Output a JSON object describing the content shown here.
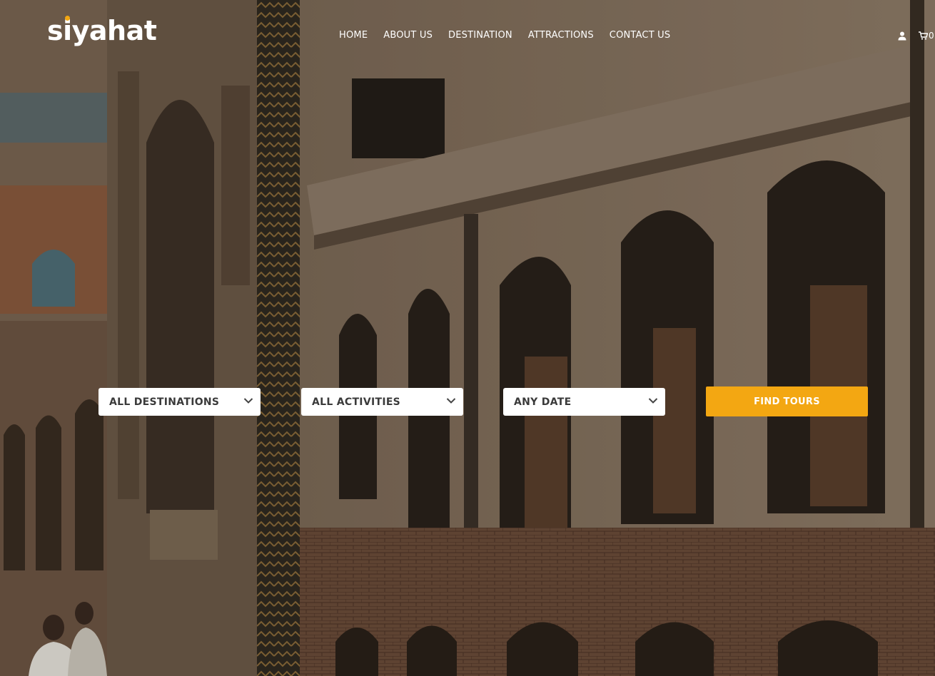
{
  "brand": {
    "logo_text": "siyahat",
    "accent_color": "#f3a712"
  },
  "nav": {
    "items": [
      {
        "label": "HOME"
      },
      {
        "label": "ABOUT US"
      },
      {
        "label": "DESTINATION"
      },
      {
        "label": "ATTRACTIONS"
      },
      {
        "label": "CONTACT US"
      }
    ]
  },
  "header_icons": {
    "account_icon": "user-icon",
    "cart_icon": "cart-icon",
    "cart_count": "0"
  },
  "search": {
    "destination": {
      "selected": "ALL DESTINATIONS",
      "icon": "chevron-down-icon"
    },
    "activity": {
      "selected": "ALL ACTIVITIES",
      "icon": "chevron-down-icon"
    },
    "date": {
      "selected": "ANY DATE",
      "icon": "chevron-down-icon"
    },
    "submit_label": "FIND TOURS"
  },
  "hero": {
    "background": "photo of historic brick building with pointed arch windows"
  }
}
